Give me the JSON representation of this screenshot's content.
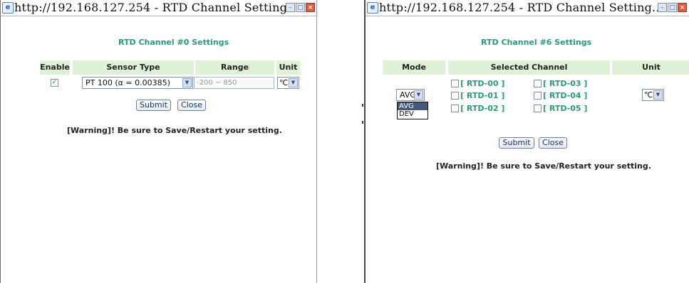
{
  "window1": {
    "title": "http://192.168.127.254 - RTD Channel Setting...",
    "heading": "RTD Channel #0 Settings",
    "table_headers": {
      "enable": "Enable",
      "sensor_type": "Sensor Type",
      "range": "Range",
      "unit": "Unit"
    },
    "row": {
      "enable_checked": true,
      "sensor_type_value": "PT 100 (α = 0.00385)",
      "range_value": "-200 ~ 850",
      "unit_value": "℃"
    },
    "buttons": {
      "submit": "Submit",
      "close": "Close"
    },
    "warning": "[Warning]! Be sure to Save/Restart your setting."
  },
  "window2": {
    "title": "http://192.168.127.254 - RTD Channel Setting...",
    "heading": "RTD Channel #6 Settings",
    "table_headers": {
      "mode": "Mode",
      "selected_channel": "Selected Channel",
      "unit": "Unit"
    },
    "mode_value": "AVG",
    "mode_options": [
      "AVG",
      "DEV"
    ],
    "channels": [
      "[ RTD-00 ]",
      "[ RTD-01 ]",
      "[ RTD-02 ]",
      "[ RTD-03 ]",
      "[ RTD-04 ]",
      "[ RTD-05 ]"
    ],
    "unit_value": "℃",
    "buttons": {
      "submit": "Submit",
      "close": "Close"
    },
    "warning": "[Warning]! Be sure to Save/Restart your setting."
  },
  "icons": {
    "browser": "ie-page-icon",
    "minimize": "minimize-icon",
    "maximize": "maximize-icon",
    "close": "close-icon",
    "dropdown": "chevron-down-icon"
  },
  "colors": {
    "heading": "#2a9a7a",
    "header_bg": "#dff2d8",
    "close_button": "#e05a3c"
  }
}
